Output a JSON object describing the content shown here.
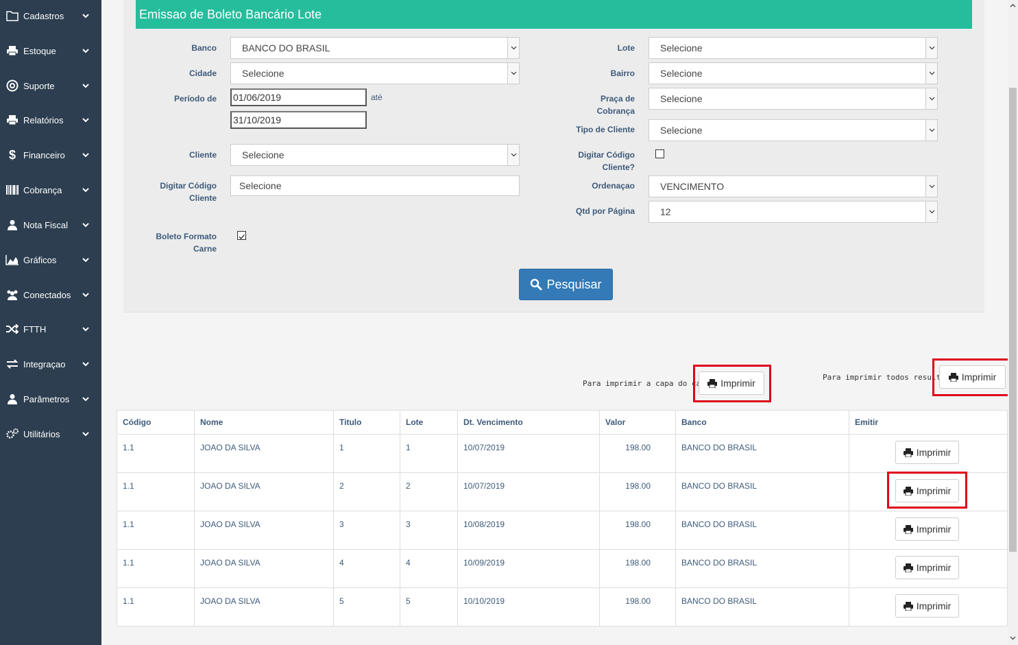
{
  "sidebar": {
    "items": [
      {
        "label": "Cadastros",
        "icon": "folder-icon"
      },
      {
        "label": "Estoque",
        "icon": "printer-icon"
      },
      {
        "label": "Suporte",
        "icon": "lifebuoy-icon"
      },
      {
        "label": "Relatórios",
        "icon": "printer-icon"
      },
      {
        "label": "Financeiro",
        "icon": "dollar-icon"
      },
      {
        "label": "Cobrança",
        "icon": "barcode-icon"
      },
      {
        "label": "Nota Fiscal",
        "icon": "user-icon"
      },
      {
        "label": "Gráficos",
        "icon": "area-chart-icon"
      },
      {
        "label": "Conectados",
        "icon": "users-icon"
      },
      {
        "label": "FTTH",
        "icon": "shuffle-icon"
      },
      {
        "label": "Integraçao",
        "icon": "exchange-icon"
      },
      {
        "label": "Parâmetros",
        "icon": "user-icon"
      },
      {
        "label": "Utilitários",
        "icon": "cogs-icon"
      }
    ]
  },
  "header": {
    "title": "Emissao de Boleto Bancário Lote"
  },
  "form": {
    "banco": {
      "label": "Banco",
      "value": "BANCO DO BRASIL"
    },
    "cidade": {
      "label": "Cidade",
      "value": "Selecione"
    },
    "periodo": {
      "label": "Período de",
      "from": "01/06/2019",
      "ate": "até",
      "to": "31/10/2019"
    },
    "cliente": {
      "label": "Cliente",
      "value": "Selecione"
    },
    "digitar_codigo": {
      "label_1": "Digitar Código",
      "label_2": "Cliente",
      "placeholder": "Selecione"
    },
    "boleto_formato": {
      "label_1": "Boleto Formato",
      "label_2": "Carne",
      "checked": true
    },
    "lote": {
      "label": "Lote",
      "value": "Selecione"
    },
    "bairro": {
      "label": "Bairro",
      "value": "Selecione"
    },
    "praca": {
      "label_1": "Praça de",
      "label_2": "Cobrança",
      "value": "Selecione"
    },
    "tipo_cliente": {
      "label": "Tipo de Cliente",
      "value": "Selecione"
    },
    "digitar_codigo_q": {
      "label_1": "Digitar Código",
      "label_2": "Cliente?",
      "checked": false
    },
    "ordenacao": {
      "label": "Ordenaçao",
      "value": "VENCIMENTO"
    },
    "qtd_pagina": {
      "label": "Qtd por Página",
      "value": "12"
    },
    "search_label": "Pesquisar"
  },
  "print": {
    "capa_note": "Para imprimir a capa do carnê",
    "todos_note": "Para imprimir todos resultados",
    "button_label": "Imprimir"
  },
  "table": {
    "headers": [
      "Código",
      "Nome",
      "Titulo",
      "Lote",
      "Dt. Vencimento",
      "Valor",
      "Banco",
      "Emitir"
    ],
    "rows": [
      {
        "codigo": "1.1",
        "nome": "JOAO DA SILVA",
        "titulo": "1",
        "lote": "1",
        "vencimento": "10/07/2019",
        "valor": "198.00",
        "banco": "BANCO DO BRASIL"
      },
      {
        "codigo": "1.1",
        "nome": "JOAO DA SILVA",
        "titulo": "2",
        "lote": "2",
        "vencimento": "10/07/2019",
        "valor": "198.00",
        "banco": "BANCO DO BRASIL"
      },
      {
        "codigo": "1.1",
        "nome": "JOAO DA SILVA",
        "titulo": "3",
        "lote": "3",
        "vencimento": "10/08/2019",
        "valor": "198.00",
        "banco": "BANCO DO BRASIL"
      },
      {
        "codigo": "1.1",
        "nome": "JOAO DA SILVA",
        "titulo": "4",
        "lote": "4",
        "vencimento": "10/09/2019",
        "valor": "198.00",
        "banco": "BANCO DO BRASIL"
      },
      {
        "codigo": "1.1",
        "nome": "JOAO DA SILVA",
        "titulo": "5",
        "lote": "5",
        "vencimento": "10/10/2019",
        "valor": "198.00",
        "banco": "BANCO DO BRASIL"
      }
    ]
  },
  "colors": {
    "sidebar": "#2c3e50",
    "header": "#26bd9c",
    "primary": "#337ab7",
    "highlight": "#e0001b"
  }
}
